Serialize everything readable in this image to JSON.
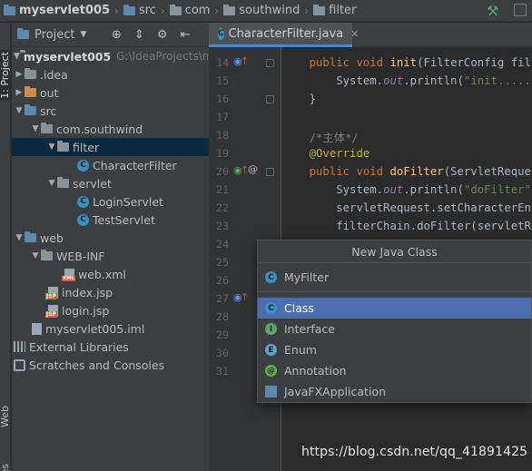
{
  "breadcrumb": [
    {
      "label": "myservlet005",
      "icon": "module-folder-icon"
    },
    {
      "label": "src",
      "icon": "folder-icon"
    },
    {
      "label": "com",
      "icon": "folder-icon"
    },
    {
      "label": "southwind",
      "icon": "folder-icon"
    },
    {
      "label": "filter",
      "icon": "folder-icon"
    }
  ],
  "left_strip": {
    "project_tab": "1: Project",
    "web_tab": "Web",
    "favorites_tab": "orites"
  },
  "project_panel": {
    "title": "Project"
  },
  "tree": [
    {
      "label": "myservlet005",
      "hint": "G:\\IdeaProjects\\my",
      "arrow": "▼",
      "icon": "module-folder-icon"
    },
    {
      "label": ".idea",
      "arrow": "▶",
      "icon": "folder-icon"
    },
    {
      "label": "out",
      "arrow": "▶",
      "icon": "excluded-folder-icon"
    },
    {
      "label": "src",
      "arrow": "▼",
      "icon": "source-folder-icon"
    },
    {
      "label": "com.southwind",
      "arrow": "▼",
      "icon": "package-icon"
    },
    {
      "label": "filter",
      "arrow": "▼",
      "icon": "package-icon"
    },
    {
      "label": "CharacterFilter",
      "arrow": "",
      "icon": "class-icon"
    },
    {
      "label": "servlet",
      "arrow": "▼",
      "icon": "package-icon"
    },
    {
      "label": "LoginServlet",
      "arrow": "",
      "icon": "class-icon"
    },
    {
      "label": "TestServlet",
      "arrow": "",
      "icon": "class-icon"
    },
    {
      "label": "web",
      "arrow": "▼",
      "icon": "web-folder-icon"
    },
    {
      "label": "WEB-INF",
      "arrow": "▼",
      "icon": "folder-icon"
    },
    {
      "label": "web.xml",
      "arrow": "",
      "icon": "xml-file-icon"
    },
    {
      "label": "index.jsp",
      "arrow": "",
      "icon": "jsp-file-icon"
    },
    {
      "label": "login.jsp",
      "arrow": "",
      "icon": "jsp-file-icon"
    },
    {
      "label": "myservlet005.iml",
      "arrow": "",
      "icon": "iml-file-icon"
    },
    {
      "label": "External Libraries",
      "arrow": "▶",
      "icon": "library-icon"
    },
    {
      "label": "Scratches and Consoles",
      "arrow": "",
      "icon": "scratch-icon"
    }
  ],
  "editor_tab": {
    "label": "CharacterFilter.java"
  },
  "line_numbers": [
    "14",
    "15",
    "16",
    "17",
    "18",
    "19",
    "20",
    "21",
    "22",
    "23",
    "24",
    "25",
    "26",
    "27",
    "28",
    "29",
    "30",
    "31"
  ],
  "code_lines": [
    {
      "indent": "    ",
      "parts": [
        {
          "t": "public void ",
          "c": "kw"
        },
        {
          "t": "init",
          "c": "fn"
        },
        {
          "t": "(FilterConfig filterC",
          "c": ""
        }
      ]
    },
    {
      "indent": "        ",
      "parts": [
        {
          "t": "System.",
          "c": ""
        },
        {
          "t": "out",
          "c": "it"
        },
        {
          "t": ".println(",
          "c": ""
        },
        {
          "t": "\"init......\"",
          "c": "st"
        },
        {
          "t": ");",
          "c": ""
        }
      ]
    },
    {
      "indent": "    ",
      "parts": [
        {
          "t": "}",
          "c": ""
        }
      ]
    },
    {
      "indent": "",
      "parts": []
    },
    {
      "indent": "    ",
      "parts": [
        {
          "t": "/*主体*/",
          "c": "cm"
        }
      ]
    },
    {
      "indent": "    ",
      "parts": [
        {
          "t": "@Override",
          "c": "an"
        }
      ]
    },
    {
      "indent": "    ",
      "parts": [
        {
          "t": "public void ",
          "c": "kw"
        },
        {
          "t": "doFilter",
          "c": "fn"
        },
        {
          "t": "(ServletRequest s",
          "c": ""
        }
      ]
    },
    {
      "indent": "        ",
      "parts": [
        {
          "t": "System.",
          "c": ""
        },
        {
          "t": "out",
          "c": "it"
        },
        {
          "t": ".println(",
          "c": ""
        },
        {
          "t": "\"doFilter\"",
          "c": "st"
        },
        {
          "t": ");",
          "c": ""
        }
      ]
    },
    {
      "indent": "        ",
      "parts": [
        {
          "t": "servletRequest.setCharacterEncodi",
          "c": ""
        }
      ]
    },
    {
      "indent": "        ",
      "parts": [
        {
          "t": "filterChain.doFilter(servletReque",
          "c": ""
        }
      ]
    }
  ],
  "dialog": {
    "title": "New Java Class",
    "name_value": "MyFilter",
    "kinds": [
      {
        "label": "Class",
        "icon": "class-icon",
        "letter": "C",
        "selected": true
      },
      {
        "label": "Interface",
        "icon": "interface-icon",
        "letter": "I",
        "selected": false
      },
      {
        "label": "Enum",
        "icon": "enum-icon",
        "letter": "E",
        "selected": false
      },
      {
        "label": "Annotation",
        "icon": "annotation-icon",
        "letter": "@",
        "selected": false
      },
      {
        "label": "JavaFXApplication",
        "icon": "javafx-icon",
        "letter": "",
        "selected": false
      }
    ]
  },
  "watermark": "https://blog.csdn.net/qq_41891425",
  "colors": {
    "selection": "#0d293e",
    "dialog_selection": "#4b6eaf",
    "keyword": "#cc7832",
    "function": "#ffc66d",
    "string": "#6a8759"
  }
}
